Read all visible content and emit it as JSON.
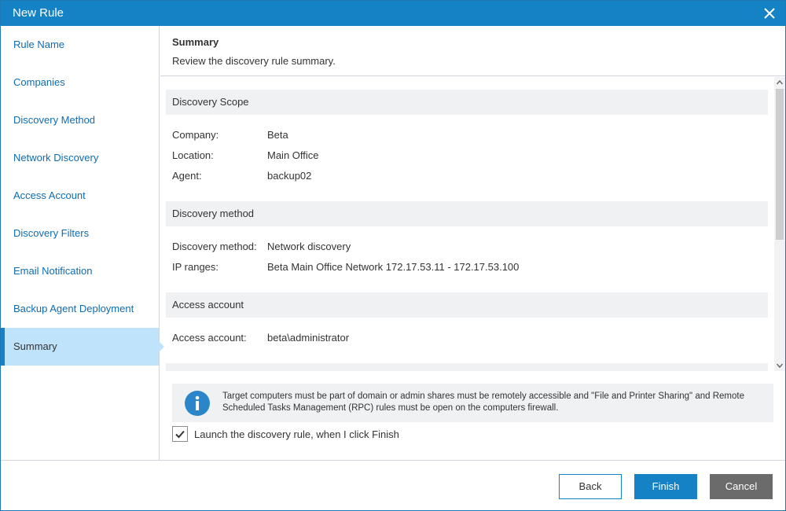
{
  "window": {
    "title": "New Rule"
  },
  "sidebar": {
    "items": [
      {
        "label": "Rule Name"
      },
      {
        "label": "Companies"
      },
      {
        "label": "Discovery Method"
      },
      {
        "label": "Network Discovery"
      },
      {
        "label": "Access Account"
      },
      {
        "label": "Discovery Filters"
      },
      {
        "label": "Email Notification"
      },
      {
        "label": "Backup Agent Deployment"
      },
      {
        "label": "Summary"
      }
    ],
    "active_item": "Summary"
  },
  "header": {
    "title": "Summary",
    "subtitle": "Review the discovery rule summary."
  },
  "summary": {
    "scope": {
      "heading": "Discovery Scope",
      "rows": [
        {
          "key": "Company:",
          "value": "Beta"
        },
        {
          "key": "Location:",
          "value": "Main Office"
        },
        {
          "key": "Agent:",
          "value": "backup02"
        }
      ]
    },
    "method": {
      "heading": "Discovery method",
      "rows": [
        {
          "key": "Discovery method:",
          "value": "Network discovery"
        },
        {
          "key": "IP ranges:",
          "value": "Beta Main Office Network 172.17.53.11 - 172.17.53.100"
        }
      ]
    },
    "access": {
      "heading": "Access account",
      "rows": [
        {
          "key": "Access account:",
          "value": "beta\\administrator"
        }
      ]
    }
  },
  "info": {
    "text": "Target computers must be part of domain or admin shares must be remotely accessible and \"File and Printer Sharing\" and Remote Scheduled Tasks Management (RPC) rules must be open on the computers firewall.",
    "icon": "info-icon"
  },
  "launch_checkbox": {
    "label": "Launch the discovery rule, when I click Finish",
    "checked": true
  },
  "footer": {
    "back_label": "Back",
    "finish_label": "Finish",
    "cancel_label": "Cancel"
  },
  "colors": {
    "accent": "#1482c5",
    "nav_link": "#0f6cb0",
    "active_bg": "#bfe3fb",
    "section_bg": "#eff1f2",
    "cancel_bg": "#6b6b6b"
  }
}
